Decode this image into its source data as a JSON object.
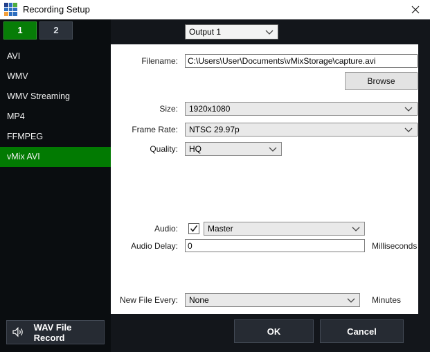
{
  "window": {
    "title": "Recording Setup"
  },
  "tabs": [
    {
      "label": "1",
      "selected": true
    },
    {
      "label": "2",
      "selected": false
    }
  ],
  "output_select": {
    "value": "Output 1"
  },
  "sidebar": {
    "items": [
      {
        "label": "AVI",
        "selected": false
      },
      {
        "label": "WMV",
        "selected": false
      },
      {
        "label": "WMV Streaming",
        "selected": false
      },
      {
        "label": "MP4",
        "selected": false
      },
      {
        "label": "FFMPEG",
        "selected": false
      },
      {
        "label": "vMix AVI",
        "selected": true
      }
    ]
  },
  "form": {
    "filename": {
      "label": "Filename:",
      "value": "C:\\Users\\User\\Documents\\vMixStorage\\capture.avi"
    },
    "browse_label": "Browse",
    "size": {
      "label": "Size:",
      "value": "1920x1080"
    },
    "frame_rate": {
      "label": "Frame Rate:",
      "value": "NTSC 29.97p"
    },
    "quality": {
      "label": "Quality:",
      "value": "HQ"
    },
    "audio": {
      "label": "Audio:",
      "checked": true,
      "value": "Master"
    },
    "audio_delay": {
      "label": "Audio Delay:",
      "value": "0",
      "unit": "Milliseconds"
    },
    "new_file_every": {
      "label": "New File Every:",
      "value": "None",
      "unit": "Minutes"
    }
  },
  "footer": {
    "wav_button": "WAV File Record",
    "ok": "OK",
    "cancel": "Cancel"
  },
  "colors": {
    "accent_green": "#027a02",
    "tab_green": "#077d07",
    "tab_green_border": "#2ba32b",
    "dark_button": "#262b33",
    "dark_button_border": "#424954",
    "sidebar_bg": "#0a0d10",
    "frame_bg": "#13161b",
    "panel_bg": "#ffffff"
  },
  "brand": {
    "logo_grid": [
      "#24418c",
      "#2e6fc0",
      "#4fae3d",
      "#2e6fc0",
      "#2e6fc0",
      "#2e6fc0",
      "#f2a03d",
      "#2e6fc0",
      "#2e6fc0"
    ]
  }
}
